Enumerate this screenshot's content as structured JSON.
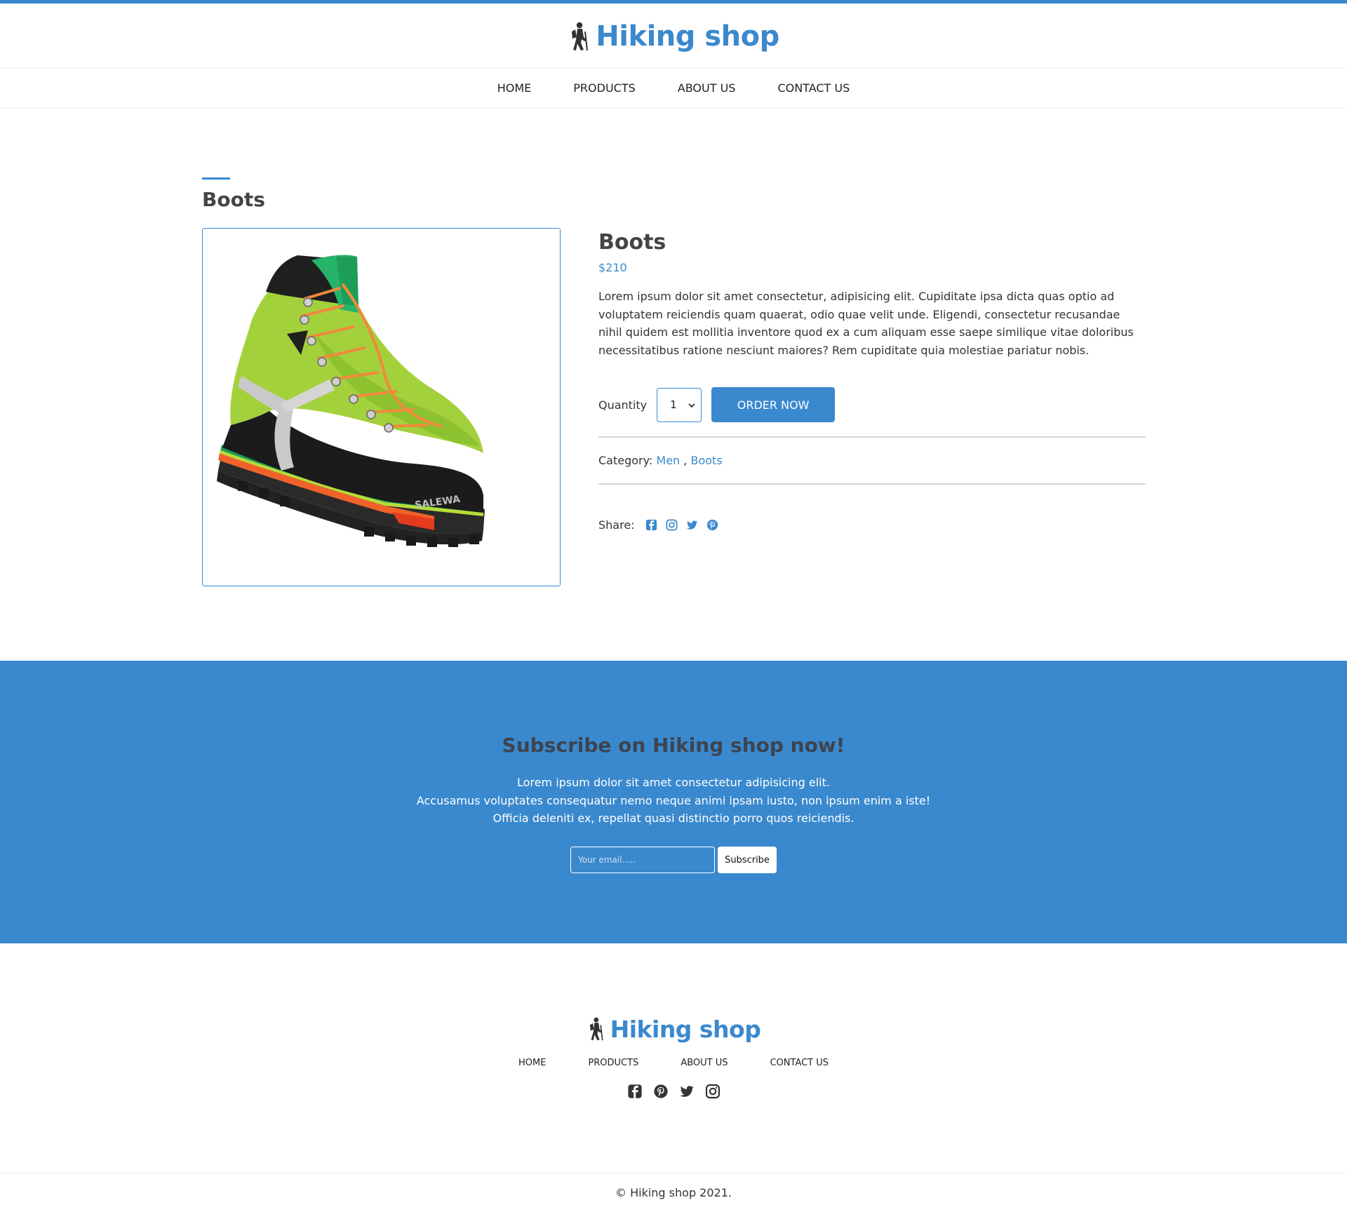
{
  "brand": {
    "name": "Hiking shop",
    "logo_icon": "hiker-icon",
    "accent_color": "#3a89ce"
  },
  "nav": {
    "items": [
      {
        "label": "HOME"
      },
      {
        "label": "PRODUCTS"
      },
      {
        "label": "ABOUT US"
      },
      {
        "label": "CONTACT US"
      }
    ]
  },
  "section": {
    "title": "Boots"
  },
  "product": {
    "image_icon": "hiking-boot-image",
    "name": "Boots",
    "price": "$210",
    "description": "Lorem ipsum dolor sit amet consectetur, adipisicing elit. Cupiditate ipsa dicta quas optio ad voluptatem reiciendis quam quaerat, odio quae velit unde. Eligendi, consectetur recusandae nihil quidem est mollitia inventore quod ex a cum aliquam esse saepe similique vitae doloribus necessitatibus ratione nesciunt maiores? Rem cupiditate quia molestiae pariatur nobis.",
    "quantity_label": "Quantity",
    "quantity_value": "1",
    "order_label": "ORDER NOW",
    "category_label": "Category:",
    "categories": [
      "Men",
      "Boots"
    ],
    "category_separator": ",",
    "share_label": "Share:",
    "share_icons": [
      "facebook-icon",
      "instagram-icon",
      "twitter-icon",
      "pinterest-icon"
    ]
  },
  "subscribe": {
    "title": "Subscribe on Hiking shop now!",
    "lines": [
      "Lorem ipsum dolor sit amet consectetur adipisicing elit.",
      "Accusamus voluptates consequatur nemo neque animi ipsam iusto, non ipsum enim a iste!",
      "Officia deleniti ex, repellat quasi distinctio porro quos reiciendis."
    ],
    "email_placeholder": "Your email.....",
    "button_label": "Subscribe"
  },
  "footer": {
    "nav": [
      {
        "label": "HOME"
      },
      {
        "label": "PRODUCTS"
      },
      {
        "label": "ABOUT US"
      },
      {
        "label": "CONTACT US"
      }
    ],
    "social_icons": [
      "facebook-icon",
      "pinterest-icon",
      "twitter-icon",
      "instagram-icon"
    ],
    "copyright": "© Hiking shop 2021."
  }
}
